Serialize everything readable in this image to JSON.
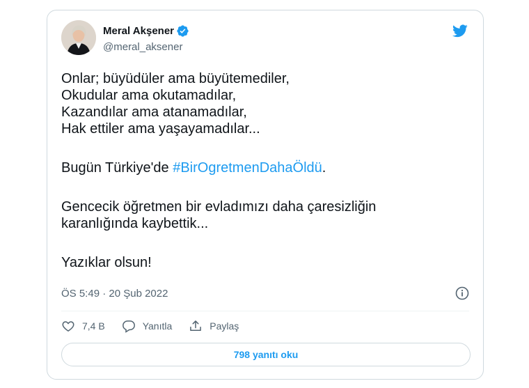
{
  "tweet": {
    "author_name": "Meral Akşener",
    "author_handle": "@meral_aksener",
    "lines": [
      "Onlar; büyüdüler ama büyütemediler,",
      "Okudular ama okutamadılar,",
      "Kazandılar ama atanamadılar,",
      "Hak ettiler ama yaşayamadılar..."
    ],
    "p2_prefix": "Bugün Türkiye'de ",
    "hashtag": "#BirOgretmenDahaÖldü",
    "p2_suffix": ".",
    "p3_lines": [
      "Gencecik öğretmen bir evladımızı daha çaresizliğin",
      "karanlığında kaybettik..."
    ],
    "p4": "Yazıklar olsun!",
    "timestamp": "ÖS 5:49 · 20 Şub 2022"
  },
  "actions": {
    "like_count": "7,4 B",
    "reply_label": "Yanıtla",
    "share_label": "Paylaş"
  },
  "read_replies_label": "798 yanıtı oku",
  "icons": {
    "verified": "verified-badge-icon",
    "brand": "twitter-bird-icon",
    "info": "info-icon",
    "like": "heart-icon",
    "reply": "speech-bubble-icon",
    "share": "share-icon"
  },
  "colors": {
    "accent": "#1d9bf0",
    "text": "#0f1419",
    "secondary": "#536471",
    "border": "#cfd9de"
  }
}
